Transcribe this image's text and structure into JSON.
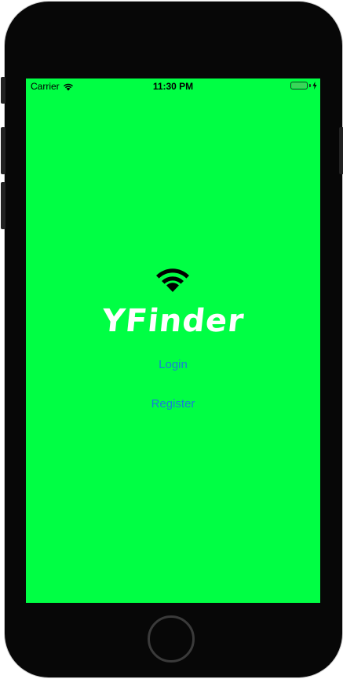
{
  "status_bar": {
    "carrier": "Carrier",
    "time": "11:30 PM",
    "wifi_icon": "wifi-icon",
    "battery_icon": "battery-icon",
    "charging_icon": "bolt-icon"
  },
  "main": {
    "logo_icon": "wifi-icon",
    "title": "YFinder",
    "login_label": "Login",
    "register_label": "Register"
  },
  "colors": {
    "screen_background": "#00ff44",
    "title": "#ffffff",
    "link": "#1a7bd9",
    "device_frame": "#070707"
  }
}
